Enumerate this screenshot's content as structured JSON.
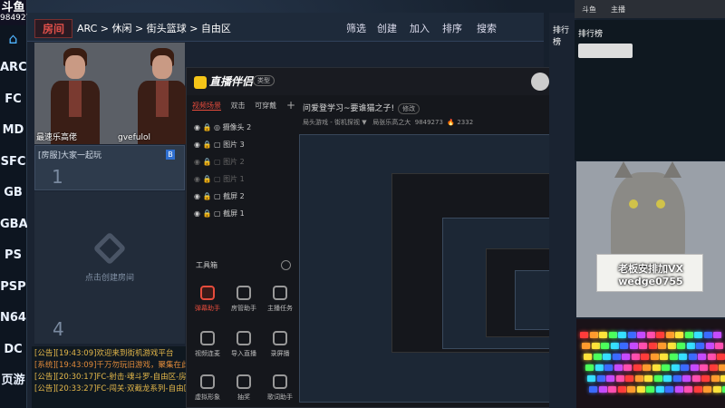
{
  "site": {
    "logo_main": "斗鱼",
    "room_id": "9849273"
  },
  "sidebar": {
    "items": [
      "ARC",
      "FC",
      "MD",
      "SFC",
      "GB",
      "GBA",
      "PS",
      "PSP",
      "N64",
      "DC",
      "页游"
    ]
  },
  "topbar": {
    "room_tag": "房间",
    "breadcrumb": "ARC > 休闲 > 街头篮球 > 自由区",
    "actions": [
      "筛选",
      "创建",
      "加入",
      "排序",
      "搜索"
    ]
  },
  "slot1": {
    "caption_left": "最速乐高佬",
    "caption_right": "gvefulol"
  },
  "room_row": {
    "title": "[房服]大家一起玩",
    "number": "1",
    "badge": "B"
  },
  "create_room": {
    "label": "点击创建房间",
    "number": "4"
  },
  "chat": {
    "lines": [
      {
        "text": "[公告][19:43:09]欢迎来到街机游戏平台",
        "kind": "notice"
      },
      {
        "text": "[系统][19:43:09]千万勿玩旧游戏，聚集在此",
        "kind": "sys"
      },
      {
        "text": "[公告][20:30:17]FC-射击·魂斗罗-自由区-房间7，第",
        "kind": "notice"
      },
      {
        "text": "[公告][20:33:27]FC-闯关·双截龙系列-自由区-房间7,第",
        "kind": "notice"
      }
    ]
  },
  "live_panel": {
    "brand": "直播伴侣",
    "tag": "类型",
    "tabs": [
      "视频场景",
      "双击",
      "可穿戴"
    ],
    "scenes": [
      {
        "label": "摄像头 2",
        "dim": false
      },
      {
        "label": "图片 3",
        "dim": false
      },
      {
        "label": "图片 2",
        "dim": true
      },
      {
        "label": "图片 1",
        "dim": true
      },
      {
        "label": "截屏 2",
        "dim": false
      },
      {
        "label": "截屏 1",
        "dim": false
      }
    ],
    "tools_title": "工具箱",
    "tools": [
      "弹幕助手",
      "房管助手",
      "主播任务",
      "视频连麦",
      "导入直播",
      "录屏播",
      "虚拟形象",
      "抽奖",
      "歌词助手"
    ],
    "stream_title": "问爱登学习~要谁猫之子!",
    "edit_btn": "修改",
    "meta_game": "局头游戏 - 街机探视 ▼",
    "meta_followers": "局张乐高之大",
    "meta_id": "9849273",
    "meta_hot": "2332"
  },
  "right": {
    "browser_tab": "排行榜",
    "top_tabs": [
      "斗鱼",
      "主播"
    ],
    "sign_line1": "老板安排加VX",
    "sign_line2": "wedge0755",
    "side_label": "排行榜"
  }
}
